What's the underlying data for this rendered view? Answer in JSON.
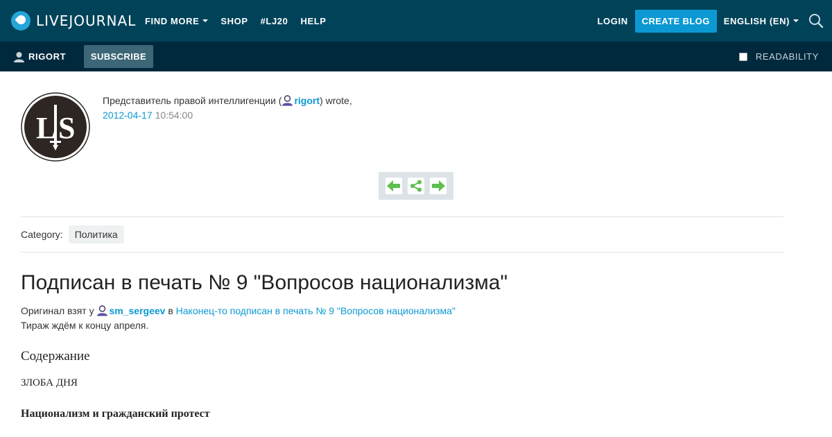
{
  "header": {
    "brand": "LIVEJOURNAL",
    "nav": [
      {
        "label": "FIND MORE",
        "has_dropdown": true
      },
      {
        "label": "SHOP",
        "has_dropdown": false
      },
      {
        "label": "#LJ20",
        "has_dropdown": false
      },
      {
        "label": "HELP",
        "has_dropdown": false
      }
    ],
    "login_label": "LOGIN",
    "create_blog_label": "CREATE BLOG",
    "language_label": "ENGLISH (EN)",
    "search_icon": "search-icon"
  },
  "subbar": {
    "username": "RIGORT",
    "subscribe_label": "SUBSCRIBE",
    "readability_label": "READABILITY"
  },
  "post": {
    "author_prefix": "Представитель правой интеллигенции (",
    "author_link": "rigort",
    "author_suffix": ") wrote,",
    "date": "2012-04-17",
    "time": "10:54:00",
    "category_label": "Category:",
    "category_tag": "Политика",
    "title": "Подписан в печать № 9 \"Вопросов национализма\"",
    "original_prefix": "Оригинал взят у",
    "original_user": "sm_sergeev",
    "original_in": "в",
    "original_link": "Наконец-то подписан в печать № 9 \"Вопросов национализма\"",
    "edition_note": "Тираж ждём к концу апреля.",
    "section_heading": "Содержание",
    "line_1": "ЗЛОБА ДНЯ",
    "line_2": "Национализм и гражданский протест"
  },
  "colors": {
    "topbar": "#004359",
    "subbar": "#00293d",
    "accent": "#0c99d3",
    "nav_arrow": "#5bbf4e"
  }
}
